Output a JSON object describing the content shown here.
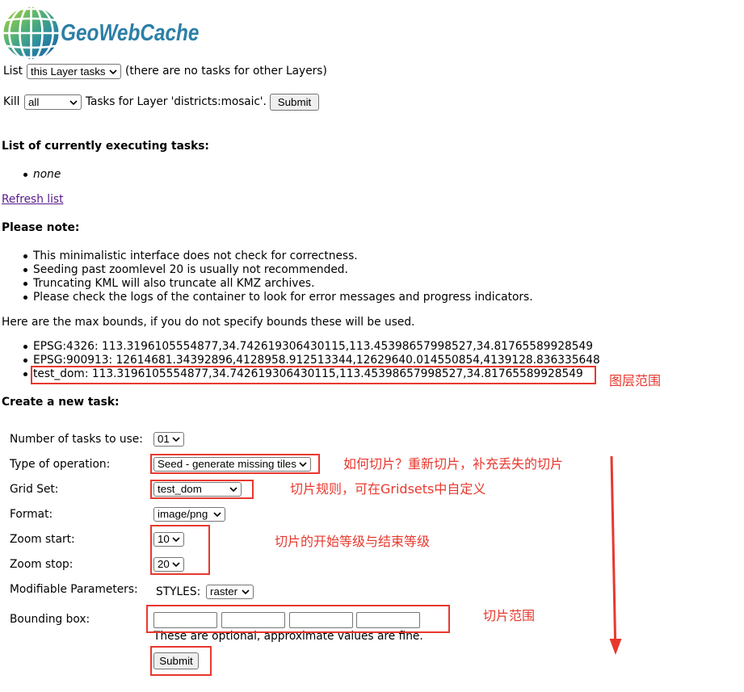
{
  "colors": {
    "logo_text": "#2c7fa6",
    "annotation_red": "#e8382e",
    "visited_link": "#551a8b"
  },
  "logo": {
    "icon": "globe-icon",
    "text": "GeoWebCache"
  },
  "list_row": {
    "label": "List",
    "select_value": "this Layer tasks",
    "note": "(there are no tasks for other Layers)"
  },
  "kill_row": {
    "label": "Kill",
    "select_value": "all",
    "text": "Tasks for Layer 'districts:mosaic'.",
    "submit_label": "Submit"
  },
  "executing": {
    "heading": "List of currently executing tasks:",
    "items": [
      "none"
    ],
    "refresh_link": "Refresh list"
  },
  "notes": {
    "heading": "Please note:",
    "items": [
      "This minimalistic interface does not check for correctness.",
      "Seeding past zoomlevel 20 is usually not recommended.",
      "Truncating KML will also truncate all KMZ archives.",
      "Please check the logs of the container to look for error messages and progress indicators."
    ]
  },
  "bounds": {
    "intro": "Here are the max bounds, if you do not specify bounds these will be used.",
    "items": [
      "EPSG:4326: 113.3196105554877,34.742619306430115,113.45398657998527,34.81765589928549",
      "EPSG:900913: 12614681.34392896,4128958.912513344,12629640.014550854,4139128.836335648",
      "test_dom: 113.3196105554877,34.742619306430115,113.45398657998527,34.81765589928549"
    ]
  },
  "create_task": {
    "heading": "Create a new task:",
    "num_tasks": {
      "label": "Number of tasks to use:",
      "value": "01"
    },
    "operation": {
      "label": "Type of operation:",
      "value": "Seed - generate missing tiles"
    },
    "gridset": {
      "label": "Grid Set:",
      "value": "test_dom"
    },
    "format": {
      "label": "Format:",
      "value": "image/png"
    },
    "zoom_start": {
      "label": "Zoom start:",
      "value": "10"
    },
    "zoom_stop": {
      "label": "Zoom stop:",
      "value": "20"
    },
    "params": {
      "label": "Modifiable Parameters:",
      "styles_label": "STYLES:",
      "styles_value": "raster"
    },
    "bbox": {
      "label": "Bounding box:",
      "values": [
        "",
        "",
        "",
        ""
      ],
      "hint": "These are optional, approximate values are fine."
    },
    "submit_label": "Submit"
  },
  "annotations": {
    "layer_bounds": "图层范围",
    "operation": "如何切片？重新切片，补充丢失的切片",
    "gridset": "切片规则，可在Gridsets中自定义",
    "zoom_levels": "切片的开始等级与结束等级",
    "bbox": "切片范围"
  }
}
